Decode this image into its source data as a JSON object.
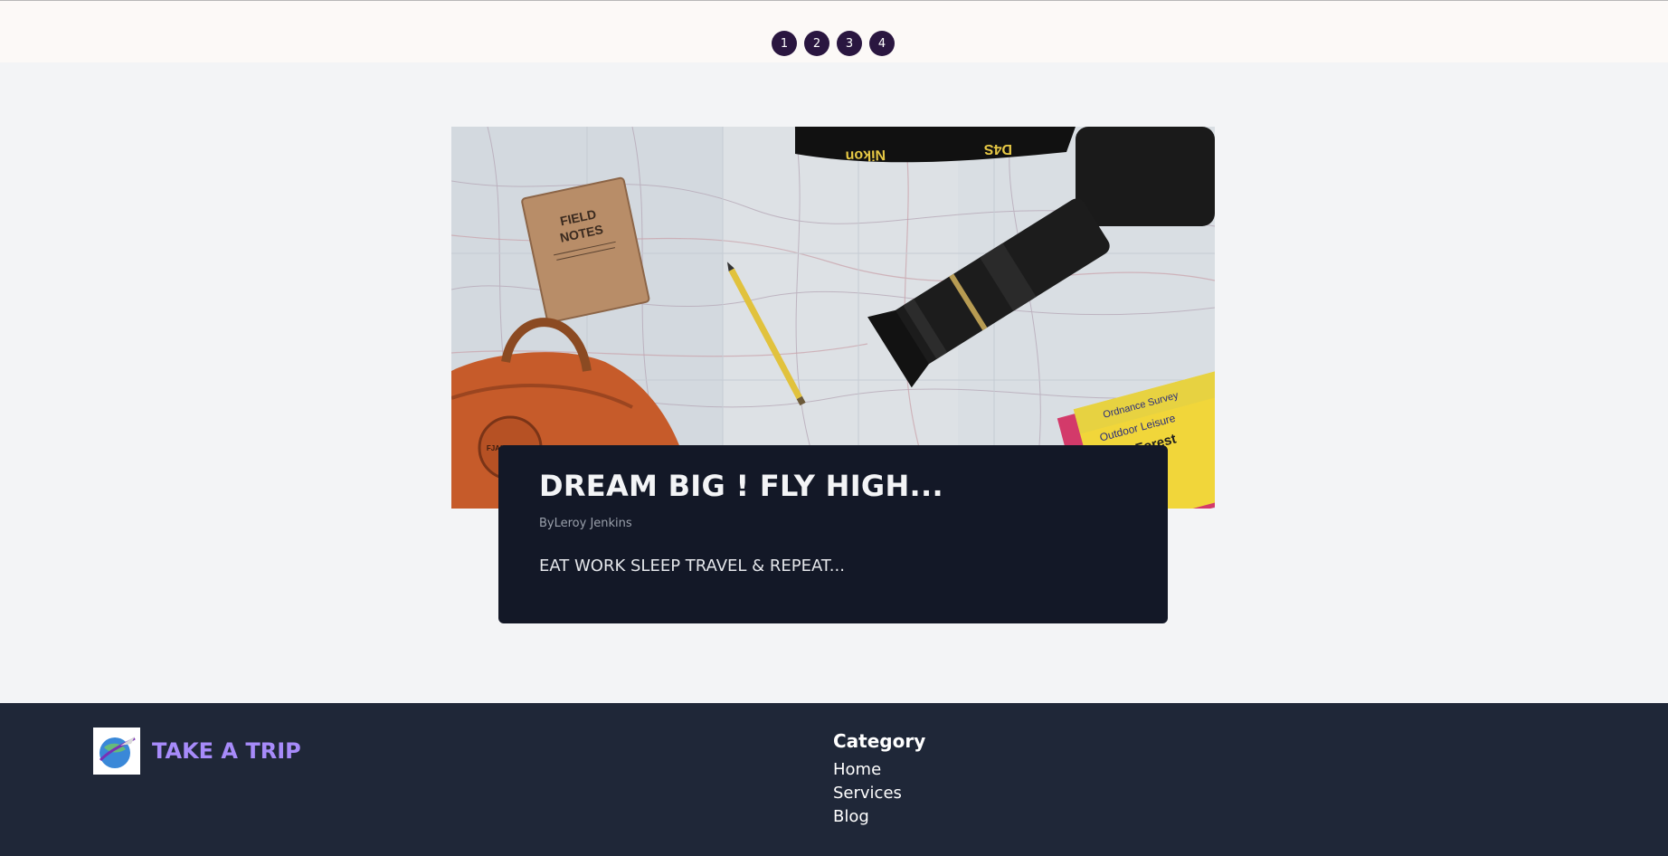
{
  "pagination": {
    "pages": [
      "1",
      "2",
      "3",
      "4"
    ]
  },
  "post": {
    "title": "DREAM BIG ! FLY HIGH...",
    "author": "ByLeroy Jenkins",
    "excerpt": "EAT WORK SLEEP TRAVEL & REPEAT...",
    "image": {
      "notebook_line1": "FIELD",
      "notebook_line2": "NOTES",
      "strap_text1": "Nikon",
      "strap_text2": "D4S",
      "map_text1": "Ordnance Survey",
      "map_text2": "Outdoor Leisure",
      "map_text3": "New Forest",
      "bag_text": "FJALLRAVEN"
    }
  },
  "footer": {
    "brand": "TAKE A TRIP",
    "category_title": "Category",
    "links": [
      "Home",
      "Services",
      "Blog"
    ]
  },
  "colors": {
    "accent": "#a78bfa",
    "page_button": "#2a1640",
    "card_bg": "#131827",
    "footer_bg": "#1f2738"
  }
}
